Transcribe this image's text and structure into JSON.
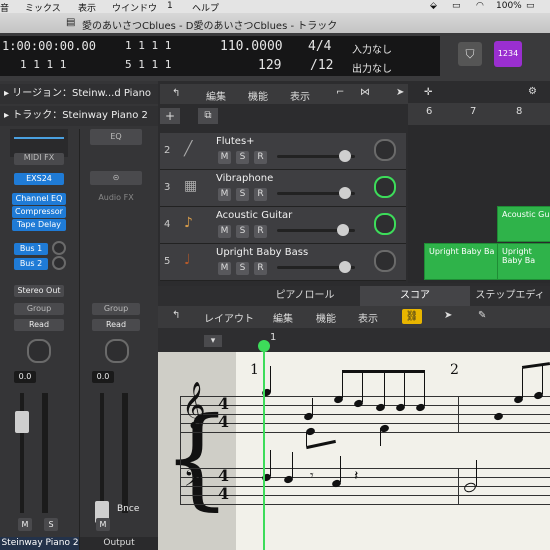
{
  "menubar": {
    "items": [
      "音",
      "ミックス",
      "表示",
      "ウインドウ",
      "1",
      "ヘルプ"
    ],
    "battery": "100%"
  },
  "window": {
    "title": "愛のあいさつCblues - D愛のあいさつCblues - トラック"
  },
  "control_bar": {
    "time_main": "1:00:00:00.00",
    "time_sub": "1  1  1      1",
    "bars_main": "1  1  1      1",
    "bars_sub": "5  1  1      1",
    "tempo_label": "110.0000",
    "tempo_value": "129",
    "signature_top": "4/4",
    "signature_bottom": "/12",
    "input_label": "入力なし",
    "output_label": "出力なし",
    "badge_label": "1234"
  },
  "inspector": {
    "region_label": "リージョン：Steinw...d Piano",
    "track_label": "トラック：Steinway Piano 2",
    "eq_label": "EQ",
    "midi_fx_label": "MIDI FX",
    "instrument_label": "EXS24",
    "audio_fx_label": "Audio FX",
    "plugins": [
      "Channel EQ",
      "Compressor",
      "Tape Delay"
    ],
    "sends": [
      "Bus 1",
      "Bus 2"
    ],
    "output_label": "Stereo Out",
    "group_label": "Group",
    "group_label_2": "Group",
    "automation_label": "Read",
    "automation_label_2": "Read",
    "volume_value": "0.0",
    "volume_value_2": "0.0",
    "mute_label": "M",
    "solo_label": "S",
    "mute_label_2": "M",
    "bounce_label": "Bnce",
    "channel_name": "Steinway Piano 2",
    "channel_name_2": "Output"
  },
  "tracks_toolbar": {
    "edit_menu": "編集",
    "functions_menu": "機能",
    "view_menu": "表示",
    "ruler_numbers": [
      "6",
      "7",
      "8"
    ]
  },
  "tracks": [
    {
      "number": "2",
      "name": "Flutes+"
    },
    {
      "number": "3",
      "name": "Vibraphone"
    },
    {
      "number": "4",
      "name": "Acoustic Guitar"
    },
    {
      "number": "5",
      "name": "Upright Baby Bass"
    }
  ],
  "track_buttons": {
    "mute": "M",
    "solo": "S",
    "record": "R"
  },
  "regions": {
    "guitar": "Acoustic Gu",
    "bass_1": "Upright Baby Ba",
    "bass_2": "Upright Baby Ba"
  },
  "editor": {
    "tabs": [
      "ピアノロール",
      "スコア",
      "ステップエディ"
    ],
    "layout_menu": "レイアウト",
    "edit_menu": "編集",
    "functions_menu": "機能",
    "view_menu": "表示",
    "ruler_number": "1",
    "measure_numbers": [
      "1",
      "2"
    ],
    "time_signature_top": "4",
    "time_signature_bottom": "4",
    "time_signature_top_2": "4",
    "time_signature_bottom_2": "4"
  },
  "colors": {
    "accent_blue": "#1f7bd6",
    "region_green": "#2fb34a",
    "playhead_green": "#3ddc5a"
  }
}
